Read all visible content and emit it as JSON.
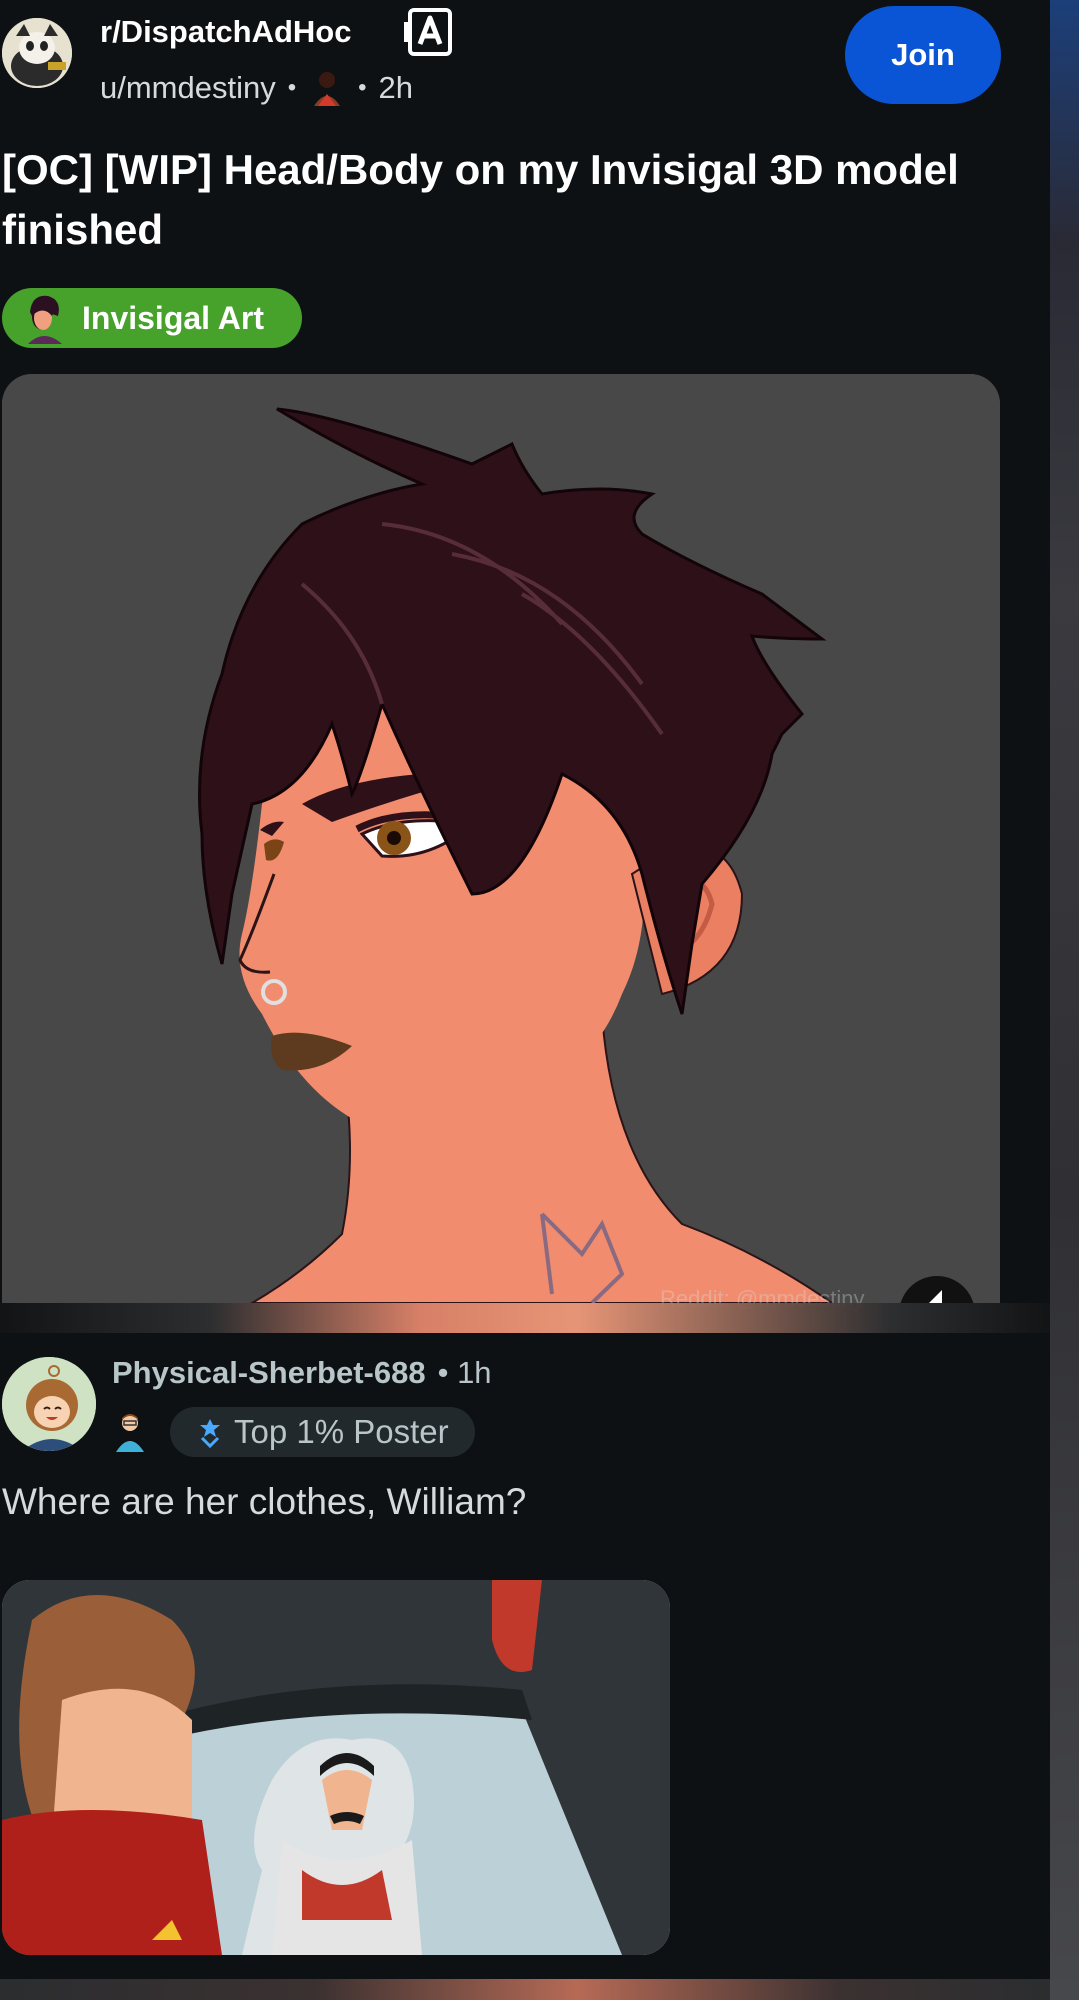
{
  "post": {
    "subreddit": "r/DispatchAdHoc",
    "author": "u/mmdestiny",
    "age": "2h",
    "join_label": "Join",
    "title": "[OC] [WIP] Head/Body on my Invisigal 3D model finished",
    "flair": "Invisigal Art",
    "image_watermark": "Reddit: @mmdestiny",
    "icons": {
      "subreddit_avatar": "subreddit-avatar-icon",
      "mod": "mod-shield-icon",
      "user_flair": "user-flair-icon",
      "flair": "invisigal-flair-icon",
      "mute": "mute-icon"
    }
  },
  "comment": {
    "author": "Physical-Sherbet-688",
    "age": "1h",
    "badge": "Top 1% Poster",
    "body": "Where are her clothes, William?",
    "icons": {
      "avatar": "commenter-avatar-icon",
      "user_flair": "user-flair-icon",
      "badge": "top-poster-icon"
    }
  },
  "colors": {
    "background": "#0e1113",
    "join_button": "#0a54d6",
    "flair_bg": "#46a22a",
    "badge_bg": "#22292d",
    "skin": "#f28c6e",
    "hair": "#2e1018"
  }
}
